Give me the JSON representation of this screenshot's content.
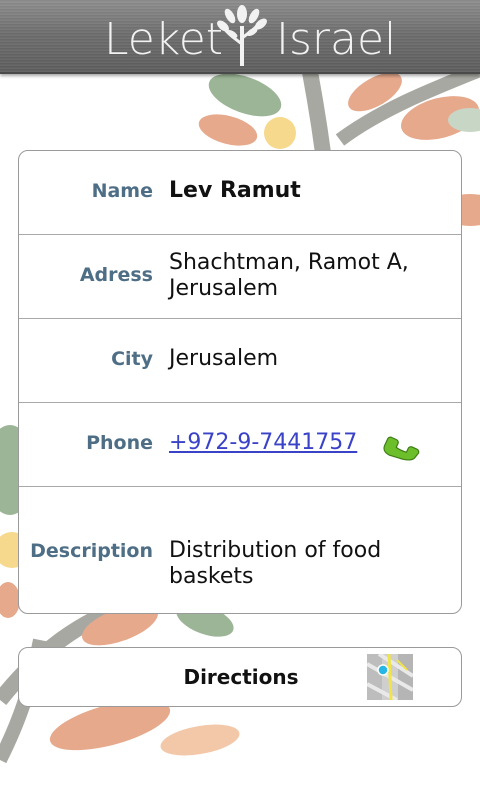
{
  "header": {
    "logo_left": "Leket",
    "logo_right": "Israel"
  },
  "details": {
    "name": {
      "label": "Name",
      "value": "Lev Ramut"
    },
    "address": {
      "label": "Adress",
      "value": "Shachtman, Ramot A, Jerusalem"
    },
    "city": {
      "label": "City",
      "value": "Jerusalem"
    },
    "phone": {
      "label": "Phone",
      "value": "+972-9-7441757"
    },
    "description": {
      "label": "Description",
      "value": "Distribution of food baskets"
    }
  },
  "directions": {
    "label": "Directions"
  },
  "icons": {
    "phone": "phone-call-icon",
    "map": "map-directions-icon",
    "logo": "tree-logo-icon"
  },
  "colors": {
    "label_text": "#4e6e86",
    "link": "#3a42c8",
    "header_bg": "#6f6f6f",
    "phone_icon": "#6cbf2a"
  }
}
